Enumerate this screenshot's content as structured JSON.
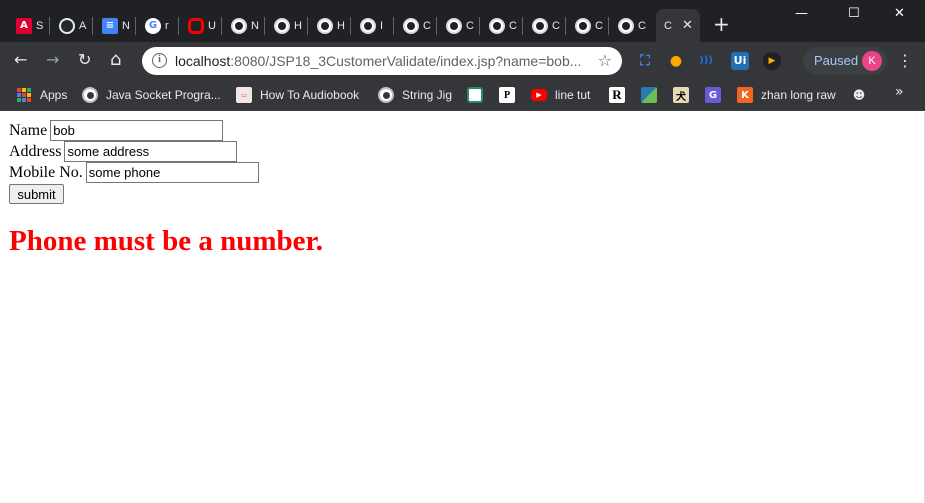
{
  "browser": {
    "tabs": [
      {
        "label": "S",
        "icon": "angular-icon",
        "color": "#dd0031"
      },
      {
        "label": "A",
        "icon": "github-icon",
        "color": "#24292e"
      },
      {
        "label": "N",
        "icon": "google-docs-icon",
        "color": "#4285f4"
      },
      {
        "label": "r",
        "icon": "google-icon",
        "color": "#ffffff"
      },
      {
        "label": "U",
        "icon": "oracle-icon",
        "color": "#f80000"
      },
      {
        "label": "N",
        "icon": "globe-icon"
      },
      {
        "label": "H",
        "icon": "globe-icon"
      },
      {
        "label": "H",
        "icon": "globe-icon"
      },
      {
        "label": "I",
        "icon": "globe-icon"
      },
      {
        "label": "C",
        "icon": "globe-icon"
      },
      {
        "label": "C",
        "icon": "globe-icon"
      },
      {
        "label": "C",
        "icon": "globe-icon"
      },
      {
        "label": "C",
        "icon": "globe-icon"
      },
      {
        "label": "C",
        "icon": "globe-icon"
      },
      {
        "label": "C",
        "icon": "globe-icon"
      }
    ],
    "active_tab": {
      "label": "C",
      "close": "✕"
    },
    "new_tab": "+",
    "window_controls": {
      "minimize": "—",
      "maximize": "☐",
      "close": "✕"
    },
    "toolbar": {
      "back": "←",
      "forward": "→",
      "reload": "↻",
      "home": "⌂",
      "url_host": "localhost",
      "url_path": ":8080/JSP18_3CustomerValidate/index.jsp?name=bob...",
      "info_icon": "i",
      "star_icon": "☆",
      "paused_label": "Paused",
      "profile_initial": "K",
      "menu": "⋮"
    },
    "extensions": [
      {
        "name": "screenshot-icon",
        "label": "⛶",
        "color": "#4285f4"
      },
      {
        "name": "bulb-icon",
        "label": "●",
        "color": "#f9ab00"
      },
      {
        "name": "wifi-icon",
        "label": ")))",
        "color": "#1a73e8"
      },
      {
        "name": "uipath-icon",
        "label": "Ui",
        "color": "#1f6fb2"
      },
      {
        "name": "media-icon",
        "label": "▶",
        "color": "#f9ab00"
      }
    ],
    "bookmarks": [
      {
        "label": "Apps",
        "icon": "apps-icon"
      },
      {
        "label": "Java Socket Progra...",
        "icon": "globe-icon"
      },
      {
        "label": "How To Audiobook",
        "icon": "audiobook-icon"
      },
      {
        "label": "String Jig",
        "icon": "globe-icon"
      },
      {
        "label": "",
        "icon": "bookmark-circle-icon"
      },
      {
        "label": "",
        "icon": "bookmark-p-icon"
      },
      {
        "label": "line tut",
        "icon": "youtube-icon"
      },
      {
        "label": "",
        "icon": "bookmark-r-icon"
      },
      {
        "label": "",
        "icon": "bookmark-map-icon"
      },
      {
        "label": "",
        "icon": "bookmark-kanji-icon"
      },
      {
        "label": "",
        "icon": "bookmark-g-icon"
      },
      {
        "label": "zhan long raw",
        "icon": "k-icon"
      },
      {
        "label": "",
        "icon": "bookmark-alien-icon"
      }
    ],
    "bookmarks_overflow": "»"
  },
  "form": {
    "name_label": "Name",
    "name_value": "bob",
    "address_label": "Address",
    "address_value": "some address",
    "mobile_label": "Mobile No.",
    "mobile_value": "some phone",
    "submit_label": "submit"
  },
  "error_message": "Phone must be a number."
}
